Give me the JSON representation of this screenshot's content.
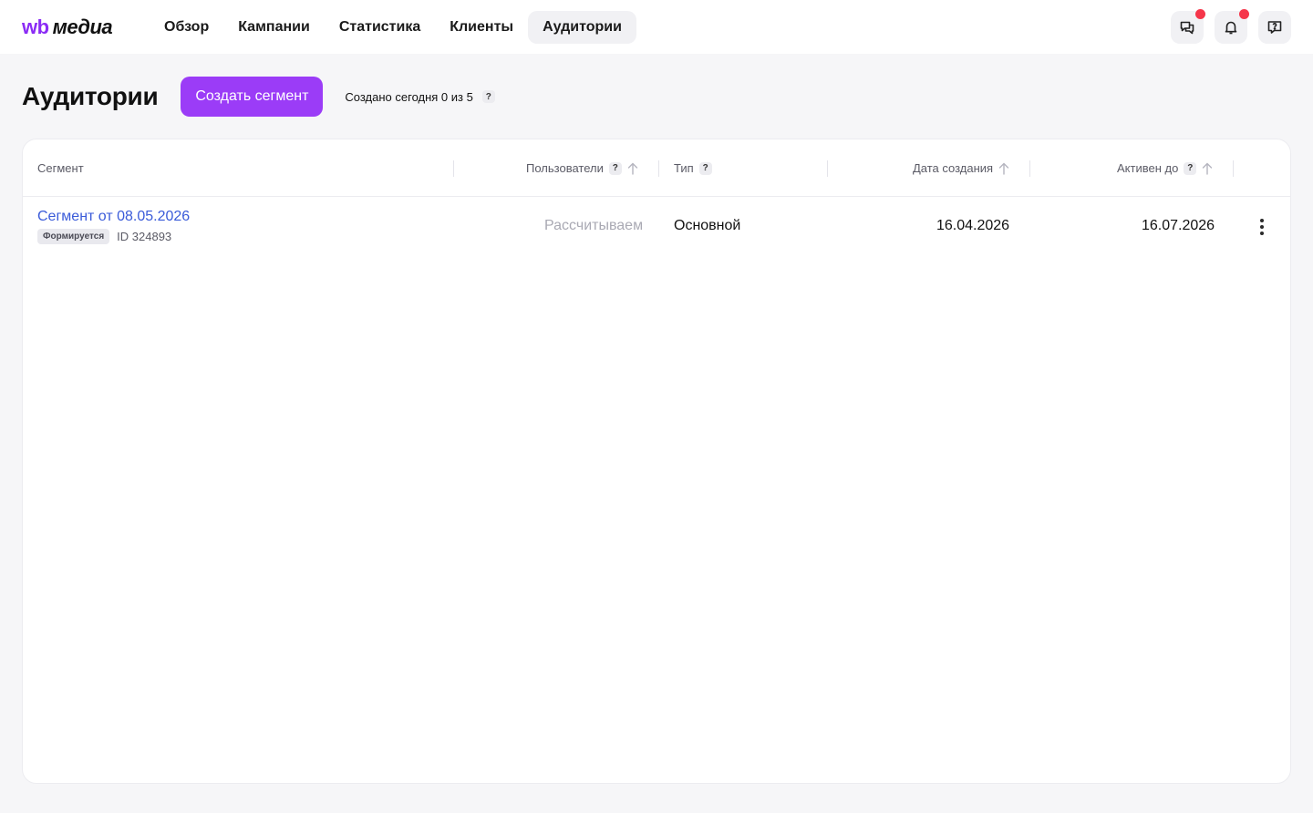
{
  "brand": {
    "wb": "wb",
    "media": "медиа",
    "accent": "#8b2cf5"
  },
  "nav": {
    "items": [
      {
        "label": "Обзор"
      },
      {
        "label": "Кампании"
      },
      {
        "label": "Статистика"
      },
      {
        "label": "Клиенты"
      },
      {
        "label": "Аудитории",
        "active": true
      }
    ]
  },
  "top_actions": [
    {
      "icon": "chat-icon",
      "has_notification": true
    },
    {
      "icon": "bell-icon",
      "has_notification": true
    },
    {
      "icon": "help-icon",
      "has_notification": false
    }
  ],
  "page": {
    "title": "Аудитории",
    "create_button": "Создать сегмент",
    "created_today": "Создано сегодня 0 из 5",
    "help": "?"
  },
  "table": {
    "columns": [
      {
        "label": "Сегмент"
      },
      {
        "label": "Пользователи",
        "help": "?",
        "sortable": true
      },
      {
        "label": "Тип",
        "help": "?"
      },
      {
        "label": "Дата создания",
        "sortable": true
      },
      {
        "label": "Активен до",
        "help": "?",
        "sortable": true
      }
    ],
    "rows": [
      {
        "name": "Сегмент от 08.05.2026",
        "status": "Формируется",
        "id": "ID 324893",
        "users": "Рассчитываем",
        "type": "Основной",
        "created": "16.04.2026",
        "active_until": "16.07.2026"
      }
    ]
  },
  "colors": {
    "primary": "#9b3cf7",
    "link": "#3a5bd9",
    "notification": "#f5364a"
  }
}
